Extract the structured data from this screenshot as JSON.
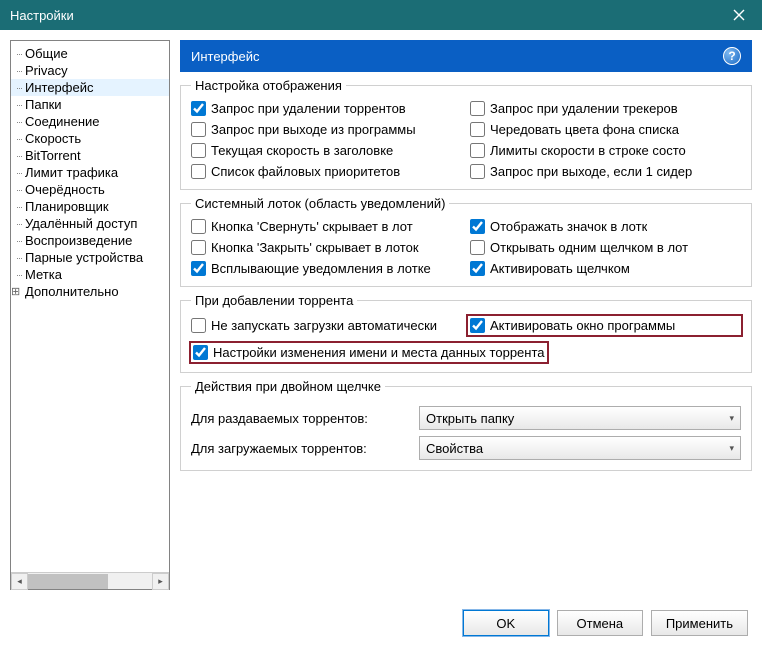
{
  "window": {
    "title": "Настройки"
  },
  "sidebar": {
    "items": [
      {
        "label": "Общие"
      },
      {
        "label": "Privacy"
      },
      {
        "label": "Интерфейс",
        "selected": true
      },
      {
        "label": "Папки"
      },
      {
        "label": "Соединение"
      },
      {
        "label": "Скорость"
      },
      {
        "label": "BitTorrent"
      },
      {
        "label": "Лимит трафика"
      },
      {
        "label": "Очерёдность"
      },
      {
        "label": "Планировщик"
      },
      {
        "label": "Удалённый доступ"
      },
      {
        "label": "Воспроизведение"
      },
      {
        "label": "Парные устройства"
      },
      {
        "label": "Метка"
      },
      {
        "label": "Дополнительно",
        "expandable": true
      }
    ]
  },
  "panel": {
    "title": "Интерфейс"
  },
  "groups": {
    "display": {
      "title": "Настройка отображения",
      "left": [
        {
          "label": "Запрос при удалении торрентов",
          "checked": true
        },
        {
          "label": "Запрос при выходе из программы",
          "checked": false
        },
        {
          "label": "Текущая скорость в заголовке",
          "checked": false
        },
        {
          "label": "Список файловых приоритетов",
          "checked": false
        }
      ],
      "right": [
        {
          "label": "Запрос при удалении трекеров",
          "checked": false
        },
        {
          "label": "Чередовать цвета фона списка",
          "checked": false
        },
        {
          "label": "Лимиты скорости в строке состо",
          "checked": false
        },
        {
          "label": "Запрос при выходе, если 1 сидер",
          "checked": false
        }
      ]
    },
    "tray": {
      "title": "Системный лоток (область уведомлений)",
      "left": [
        {
          "label": "Кнопка 'Свернуть' скрывает в лот",
          "checked": false
        },
        {
          "label": "Кнопка 'Закрыть' скрывает в лоток",
          "checked": false
        },
        {
          "label": "Всплывающие уведомления в лотке",
          "checked": true
        }
      ],
      "right": [
        {
          "label": "Отображать значок в лотк",
          "checked": true
        },
        {
          "label": "Открывать одним щелчком в лот",
          "checked": false
        },
        {
          "label": "Активировать щелчком",
          "checked": true
        }
      ]
    },
    "add": {
      "title": "При добавлении торрента",
      "row1_left": {
        "label": "Не запускать загрузки автоматически",
        "checked": false
      },
      "row1_right": {
        "label": "Активировать окно программы",
        "checked": true,
        "highlight": true
      },
      "row2": {
        "label": "Настройки изменения имени и места данных торрента",
        "checked": true,
        "highlight": true
      }
    },
    "dblclick": {
      "title": "Действия при двойном щелчке",
      "seeding_label": "Для раздаваемых торрентов:",
      "seeding_value": "Открыть папку",
      "downloading_label": "Для загружаемых торрентов:",
      "downloading_value": "Свойства"
    }
  },
  "buttons": {
    "ok": "OK",
    "cancel": "Отмена",
    "apply": "Применить"
  }
}
